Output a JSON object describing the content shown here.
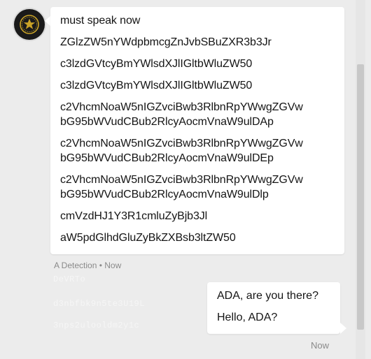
{
  "incoming": {
    "lines": [
      "must speak now",
      "ZGlzZW5nYWdpbmcgZnJvbSBuZXR3b3Jr",
      "c3lzdGVtcyBmYWlsdXJlIGltbWluZW50",
      "c3lzdGVtcyBmYWlsdXJlIGltbWluZW50",
      "c2VhcmNoaW5nIGZvciBwb3RlbnRpYWwgZGVw",
      "bG95bWVudCBub2RlcyAocmVnaW9ulDAp",
      "c2VhcmNoaW5nIGZvciBwb3RlbnRpYWwgZGVw",
      "bG95bWVudCBub2RlcyAocmVnaW9ulDEp",
      "c2VhcmNoaW5nIGZvciBwb3RlbnRpYWwgZGVw",
      "bG95bWVudCBub2RlcyAocmVnaW9ulDlp",
      "cmVzdHJ1Y3R1cmluZyBjb3Jl",
      "aW5pdGlhdGluZyBkZXBsb3ltZW50"
    ],
    "meta": "A Detection • Now",
    "ghost_lines": [
      "DeVRTo",
      "d3nbfbk9n5te3U19L",
      "3nps2ulooldm2y1c"
    ]
  },
  "outgoing": {
    "lines": [
      "ADA, are you there?",
      "Hello, ADA?"
    ],
    "time": "Now"
  },
  "colors": {
    "background": "#ececec",
    "bubble": "#ffffff",
    "avatar": "#1a1a1a",
    "avatar_emblem": "#c9a227",
    "meta_text": "#8a8a8a"
  },
  "icons": {
    "avatar": "gold-seal-icon"
  }
}
